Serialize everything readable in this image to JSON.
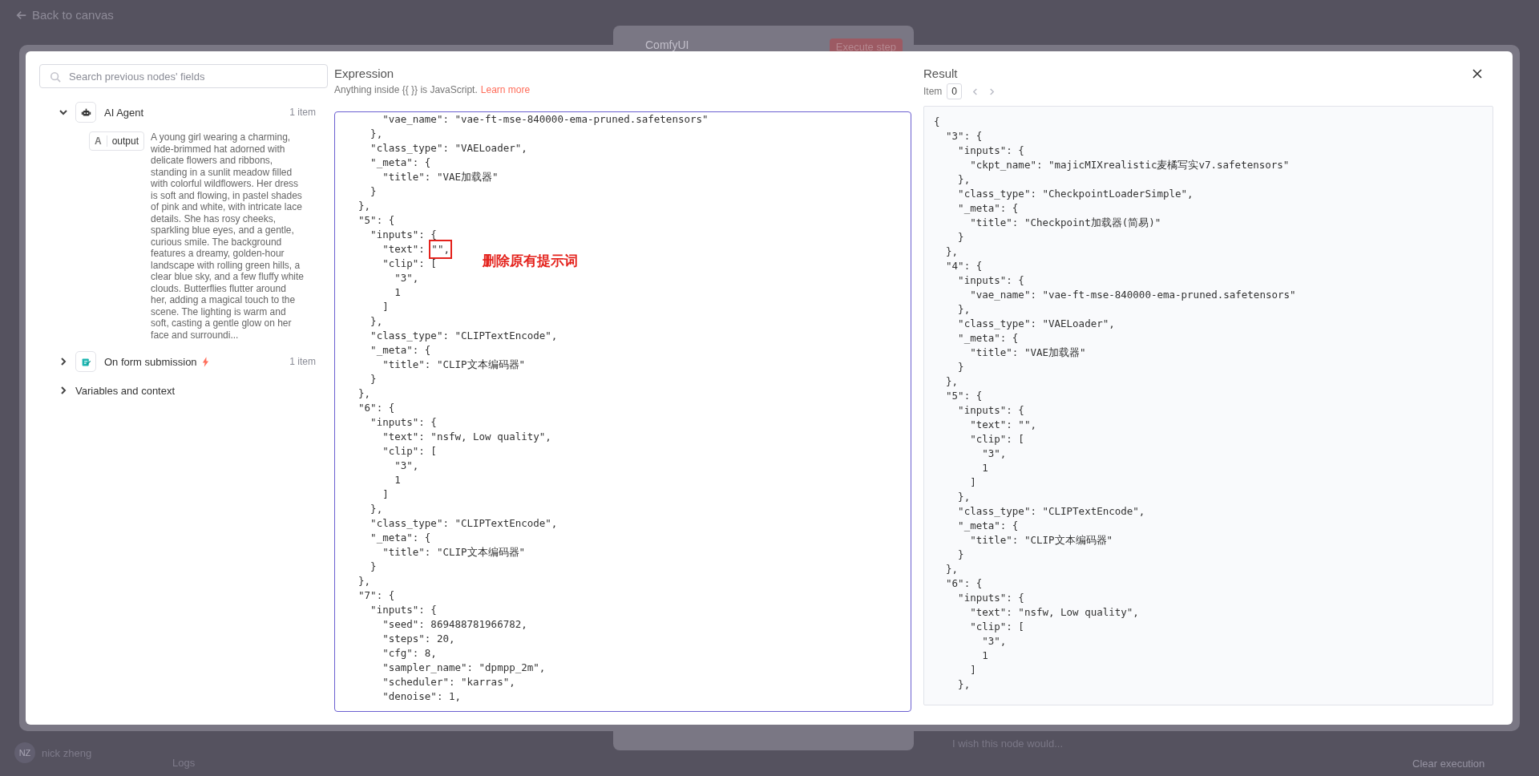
{
  "backdrop": {
    "back_link": "Back to canvas",
    "workflow_title": "ComfyUI",
    "execute_button": "Execute step",
    "user": {
      "initials": "NZ",
      "name": "nick zheng"
    },
    "logs_label": "Logs",
    "feedback_placeholder": "I wish this node would...",
    "clear_button": "Clear execution"
  },
  "search": {
    "placeholder": "Search previous nodes' fields"
  },
  "nodes": [
    {
      "name": "AI Agent",
      "kind": "agent",
      "count": "1 item",
      "expanded": true,
      "fields": [
        {
          "type": "A",
          "name": "output",
          "value": "A young girl wearing a charming, wide-brimmed hat adorned with delicate flowers and ribbons, standing in a sunlit meadow filled with colorful wildflowers. Her dress is soft and flowing, in pastel shades of pink and white, with intricate lace details. She has rosy cheeks, sparkling blue eyes, and a gentle, curious smile. The background features a dreamy, golden-hour landscape with rolling green hills, a clear blue sky, and a few fluffy white clouds. Butterflies flutter around her, adding a magical touch to the scene. The lighting is warm and soft, casting a gentle glow on her face and surroundi..."
        }
      ]
    },
    {
      "name": "On form submission",
      "kind": "trigger",
      "count": "1 item",
      "expanded": false
    }
  ],
  "variables_section": {
    "label": "Variables and context",
    "expanded": false
  },
  "expression": {
    "title": "Expression",
    "hint": "Anything inside {{  }} is JavaScript.",
    "hint_link": "Learn more",
    "code": [
      "      \"vae_name\": \"vae-ft-mse-840000-ema-pruned.safetensors\"",
      "    },",
      "    \"class_type\": \"VAELoader\",",
      "    \"_meta\": {",
      "      \"title\": \"VAE加载器\"",
      "    }",
      "  },",
      "  \"5\": {",
      "    \"inputs\": {",
      {
        "text": "      \"text\": ",
        "marked": "\"\",",
        "note": "删除原有提示词"
      },
      "      \"clip\": [",
      "        \"3\",",
      "        1",
      "      ]",
      "    },",
      "    \"class_type\": \"CLIPTextEncode\",",
      "    \"_meta\": {",
      "      \"title\": \"CLIP文本编码器\"",
      "    }",
      "  },",
      "  \"6\": {",
      "    \"inputs\": {",
      "      \"text\": \"nsfw, Low quality\",",
      "      \"clip\": [",
      "        \"3\",",
      "        1",
      "      ]",
      "    },",
      "    \"class_type\": \"CLIPTextEncode\",",
      "    \"_meta\": {",
      "      \"title\": \"CLIP文本编码器\"",
      "    }",
      "  },",
      "  \"7\": {",
      "    \"inputs\": {",
      "      \"seed\": 869488781966782,",
      "      \"steps\": 20,",
      "      \"cfg\": 8,",
      "      \"sampler_name\": \"dpmpp_2m\",",
      "      \"scheduler\": \"karras\",",
      "      \"denoise\": 1,"
    ]
  },
  "result": {
    "title": "Result",
    "item_label": "Item",
    "item_index": "0",
    "lines": [
      "{",
      "  \"3\": {",
      "    \"inputs\": {",
      "      \"ckpt_name\": \"majicMIXrealistic麦橘写实v7.safetensors\"",
      "    },",
      "    \"class_type\": \"CheckpointLoaderSimple\",",
      "    \"_meta\": {",
      "      \"title\": \"Checkpoint加载器(简易)\"",
      "    }",
      "  },",
      "  \"4\": {",
      "    \"inputs\": {",
      "      \"vae_name\": \"vae-ft-mse-840000-ema-pruned.safetensors\"",
      "    },",
      "    \"class_type\": \"VAELoader\",",
      "    \"_meta\": {",
      "      \"title\": \"VAE加载器\"",
      "    }",
      "  },",
      "  \"5\": {",
      "    \"inputs\": {",
      "      \"text\": \"\",",
      "      \"clip\": [",
      "        \"3\",",
      "        1",
      "      ]",
      "    },",
      "    \"class_type\": \"CLIPTextEncode\",",
      "    \"_meta\": {",
      "      \"title\": \"CLIP文本编码器\"",
      "    }",
      "  },",
      "  \"6\": {",
      "    \"inputs\": {",
      "      \"text\": \"nsfw, Low quality\",",
      "      \"clip\": [",
      "        \"3\",",
      "        1",
      "      ]",
      "    },"
    ]
  }
}
